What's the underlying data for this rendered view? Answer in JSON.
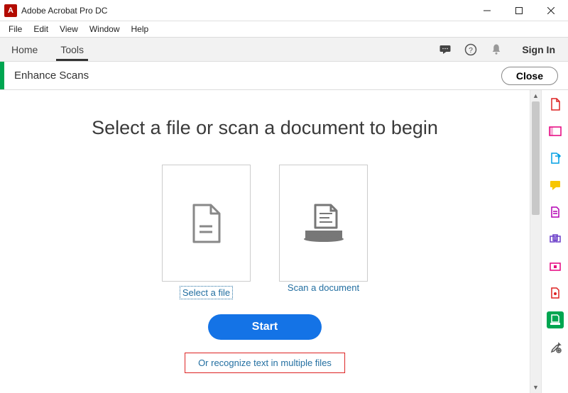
{
  "window": {
    "title": "Adobe Acrobat Pro DC",
    "logo_letter": "A"
  },
  "menu": {
    "file": "File",
    "edit": "Edit",
    "view": "View",
    "window": "Window",
    "help": "Help"
  },
  "tabs": {
    "home": "Home",
    "tools": "Tools",
    "signin": "Sign In"
  },
  "tool": {
    "name": "Enhance Scans",
    "close": "Close"
  },
  "main": {
    "heading": "Select a file or scan a document to begin",
    "select_file_label": "Select a file",
    "scan_doc_label": "Scan a document",
    "start_label": "Start",
    "multi_link": "Or recognize text in multiple files"
  },
  "rail_icons": [
    "create-pdf-icon",
    "edit-pdf-icon",
    "export-pdf-icon",
    "comment-icon",
    "organize-icon",
    "combine-icon",
    "protect-icon",
    "compress-icon",
    "enhance-scans-icon",
    "more-tools-icon"
  ]
}
